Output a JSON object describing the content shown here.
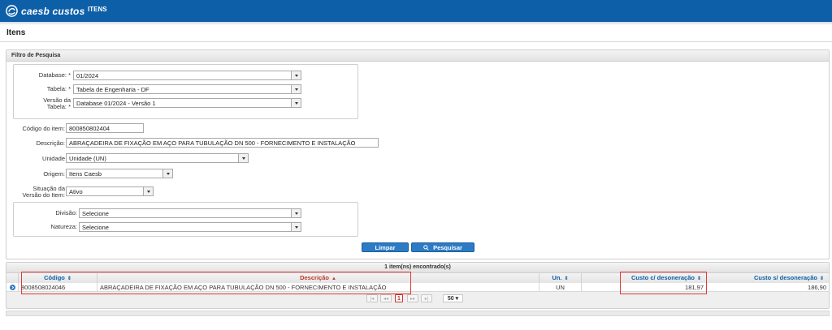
{
  "app": {
    "logo_text": "caesb custos",
    "nav_item": "ITENS"
  },
  "page": {
    "title": "Itens"
  },
  "filter": {
    "panel_title": "Filtro de Pesquisa",
    "database": {
      "label": "Database:",
      "required": "*",
      "value": "01/2024"
    },
    "tabela": {
      "label": "Tabela:",
      "required": "*",
      "value": "Tabela de Engenharia - DF"
    },
    "versao_tabela": {
      "label_line1": "Versão da",
      "label_line2": "Tabela:",
      "required": "*",
      "value": "Database 01/2024 - Versão 1"
    },
    "codigo_item": {
      "label": "Código do item:",
      "value": "800850802404"
    },
    "descricao": {
      "label": "Descrição:",
      "value": "ABRAÇADEIRA DE FIXAÇÃO EM AÇO PARA TUBULAÇÃO DN 500 - FORNECIMENTO E INSTALAÇÃO"
    },
    "unidade": {
      "label": "Unidade",
      "value": "Unidade (UN)"
    },
    "origem": {
      "label": "Origem:",
      "value": "Itens Caesb"
    },
    "situacao": {
      "label_line1": "Situação da",
      "label_line2": "Versão do Item:",
      "value": "Ativo"
    },
    "divisao": {
      "label": "Divisão:",
      "value": "Selecione"
    },
    "natureza": {
      "label": "Natureza:",
      "value": "Selecione"
    },
    "btn_limpar": "Limpar",
    "btn_pesquisar": "Pesquisar"
  },
  "results": {
    "summary": "1 item(ns) encontrado(s)",
    "columns": {
      "codigo": "Código",
      "descricao": "Descrição",
      "un": "Un.",
      "custo_com": "Custo c/ desoneração",
      "custo_sem": "Custo s/ desoneração"
    },
    "rows": [
      {
        "codigo": "8008508024046",
        "descricao": "ABRAÇADEIRA DE FIXAÇÃO EM AÇO PARA TUBULAÇÃO DN 500 - FORNECIMENTO E INSTALAÇÃO",
        "un": "UN",
        "custo_com": "181,97",
        "custo_sem": "186,90"
      }
    ],
    "pager": {
      "current_page": "1",
      "page_size": "50"
    }
  },
  "colors": {
    "brand": "#0d5fa8",
    "button": "#2d7bc5",
    "highlight": "#e03a3a"
  },
  "icons": {
    "expand_row": "expand-row-icon",
    "search": "search-icon"
  }
}
